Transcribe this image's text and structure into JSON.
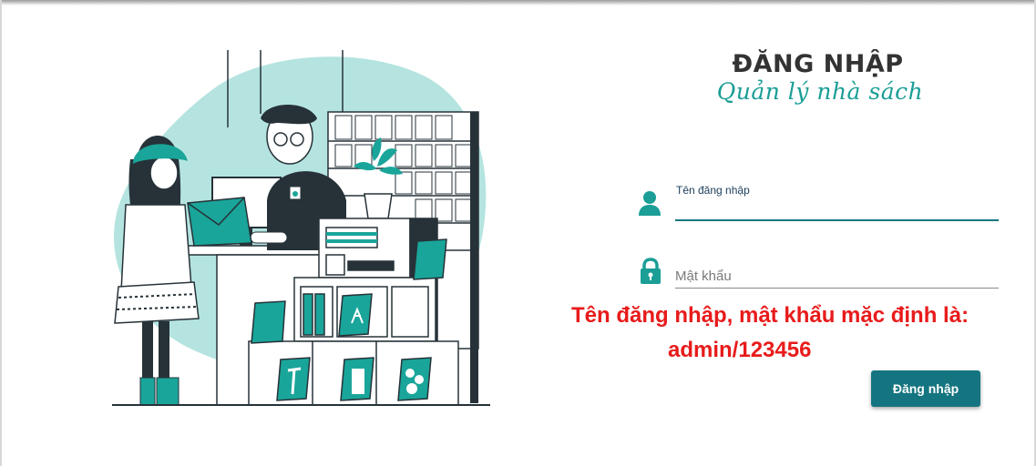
{
  "header": {
    "title": "ĐĂNG NHẬP",
    "subtitle": "Quản lý nhà sách"
  },
  "form": {
    "username_label": "Tên đăng nhập",
    "username_value": "",
    "password_placeholder": "Mật khẩu",
    "password_value": "",
    "submit_label": "Đăng nhập"
  },
  "hint": {
    "line1": "Tên đăng nhập, mật khẩu mặc định là:",
    "line2": "admin/123456"
  },
  "icons": {
    "username": "user-icon",
    "password": "lock-icon"
  },
  "colors": {
    "brand_teal": "#147580",
    "accent_teal": "#1a9e96",
    "hint_red": "#e81b1b",
    "title_dark": "#333333"
  }
}
